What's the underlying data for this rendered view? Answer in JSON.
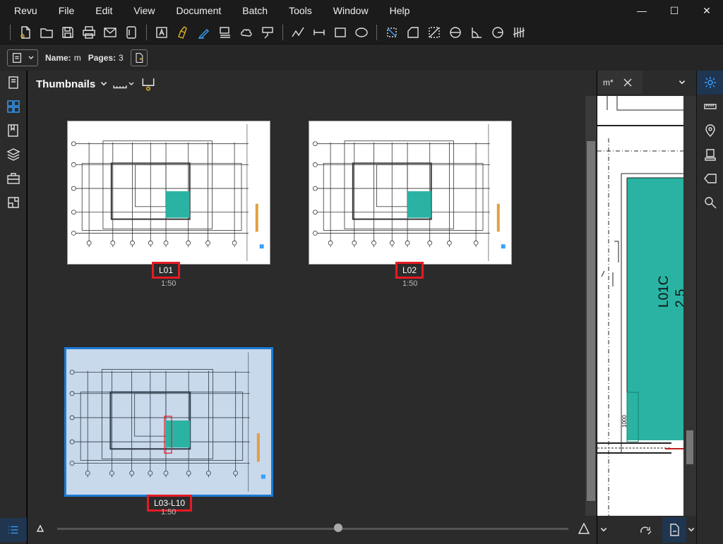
{
  "menu": [
    "Revu",
    "File",
    "Edit",
    "View",
    "Document",
    "Batch",
    "Tools",
    "Window",
    "Help"
  ],
  "window_controls": {
    "minimize": "—",
    "maximize": "☐",
    "close": "✕"
  },
  "toolbar_icons": [
    "new-document-icon",
    "open-folder-icon",
    "save-icon",
    "print-icon",
    "email-icon",
    "document-properties-icon",
    "text-box-icon",
    "highlighter-icon",
    "pen-icon",
    "stamp-icon",
    "cloud-icon",
    "callout-icon",
    "polyline-icon",
    "dimension-icon",
    "rectangle-icon",
    "ellipse-icon",
    "measure-area-icon",
    "measure-polygon-icon",
    "measure-angle-icon",
    "measure-diameter-icon",
    "measure-corner-icon",
    "measure-radius-icon",
    "measure-count-icon"
  ],
  "properties": {
    "name_label": "Name:",
    "name_value": "m",
    "pages_label": "Pages:",
    "pages_value": "3"
  },
  "panel": {
    "title": "Thumbnails"
  },
  "thumbnails": [
    {
      "label": "L01",
      "scale": "1:50",
      "selected": false
    },
    {
      "label": "L02",
      "scale": "1:50",
      "selected": false
    },
    {
      "label": "L03-L10",
      "scale": "1:50",
      "selected": true
    }
  ],
  "document_tab": {
    "title": "m*"
  },
  "drawing_text": {
    "room_label": "L01C",
    "room_dim": "2.5",
    "small_dim": "1000"
  },
  "zoom": {
    "slider_value": 0.55
  },
  "colors": {
    "accent": "#1e7bd4",
    "highlight_box": "#e51b24",
    "room_fill": "#2ab3a3"
  }
}
